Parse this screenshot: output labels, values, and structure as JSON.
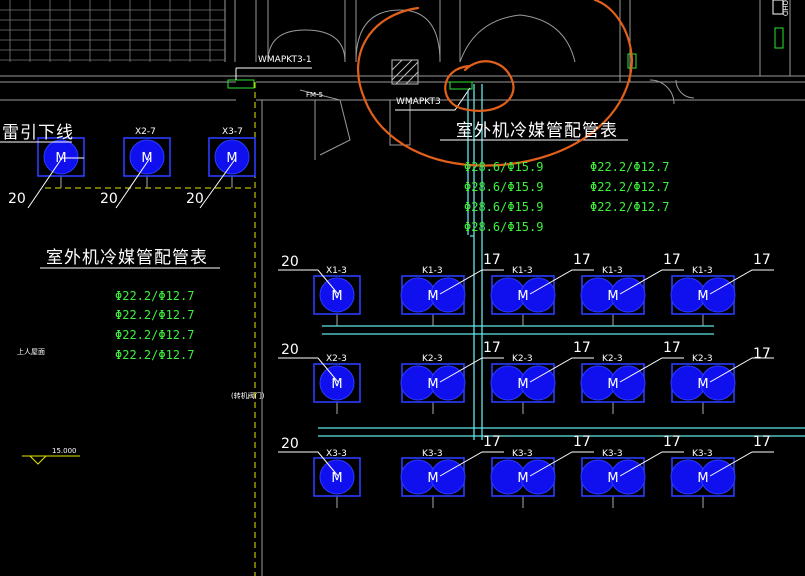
{
  "labels": {
    "wmapk_1": "WMAPKT3-1",
    "wmapk_2": "WMAPKT3",
    "fm": "FM-5",
    "lightning": "雷引下线",
    "title_right": "室外机冷媒管配管表",
    "title_left": "室外机冷媒管配管表",
    "note_left": "上人屋面",
    "note_mid": "(转机阀门)",
    "level_mark": "15.000",
    "corner_text": "QHD"
  },
  "pipe_table_left": [
    "Φ22.2/Φ12.7",
    "Φ22.2/Φ12.7",
    "Φ22.2/Φ12.7",
    "Φ22.2/Φ12.7"
  ],
  "pipe_table_right_a": [
    "Φ28.6/Φ15.9",
    "Φ28.6/Φ15.9",
    "Φ28.6/Φ15.9",
    "Φ28.6/Φ15.9"
  ],
  "pipe_table_right_b": [
    "Φ22.2/Φ12.7",
    "Φ22.2/Φ12.7",
    "Φ22.2/Φ12.7"
  ],
  "unit_tags": {
    "x2_7": "X2-7",
    "x3_7": "X3-7",
    "x1_3": "X1-3",
    "x2_3": "X2-3",
    "x3_3": "X3-3",
    "k1_3": "K1-3",
    "k2_3": "K2-3",
    "k3_3": "K3-3"
  },
  "qty_20": "20",
  "qty_17": "17",
  "motor": "M",
  "colors": {
    "unit_fill": "#1010ee",
    "unit_outline": "#2a3cff",
    "pipe": "#5fe6e6",
    "text_green": "#3ef03e",
    "markup_orange": "#e2601a",
    "dash_yellow": "#e6e600"
  }
}
